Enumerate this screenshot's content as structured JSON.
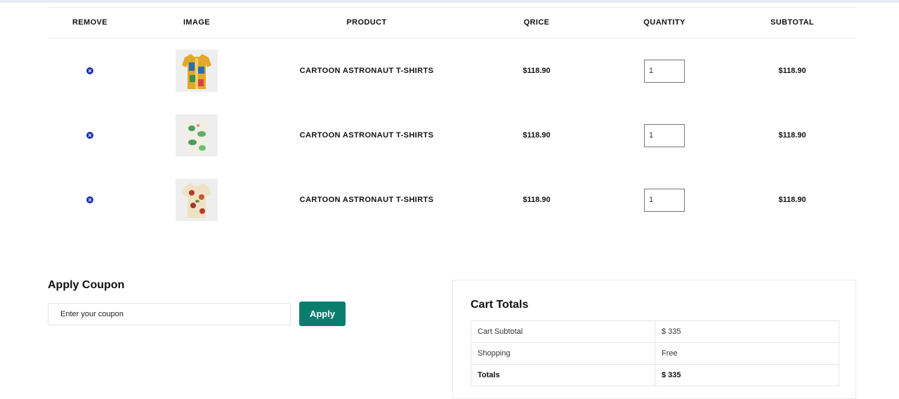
{
  "table": {
    "headers": {
      "remove": "REMOVE",
      "image": "IMAGE",
      "product": "PRODUCT",
      "price": "QRICE",
      "quantity": "QUANTITY",
      "subtotal": "SUBTOTAL"
    },
    "rows": [
      {
        "name": "CARTOON ASTRONAUT T-SHIRTS",
        "price": "$118.90",
        "quantity": "1",
        "subtotal": "$118.90",
        "image": "shirt-yellow-blue-pattern"
      },
      {
        "name": "CARTOON ASTRONAUT T-SHIRTS",
        "price": "$118.90",
        "quantity": "1",
        "subtotal": "$118.90",
        "image": "shirt-white-green-floral"
      },
      {
        "name": "CARTOON ASTRONAUT T-SHIRTS",
        "price": "$118.90",
        "quantity": "1",
        "subtotal": "$118.90",
        "image": "shirt-cream-red-floral"
      }
    ]
  },
  "coupon": {
    "title": "Apply Coupon",
    "placeholder": "Enter your coupon",
    "apply_label": "Apply"
  },
  "totals": {
    "title": "Cart Totals",
    "rows": [
      {
        "label": "Cart Subtotal",
        "value": "$ 335"
      },
      {
        "label": "Shopping",
        "value": "Free"
      },
      {
        "label": "Totals",
        "value": "$ 335"
      }
    ]
  },
  "colors": {
    "accent": "#0b7d6f",
    "remove_icon": "#1a2fb4"
  }
}
